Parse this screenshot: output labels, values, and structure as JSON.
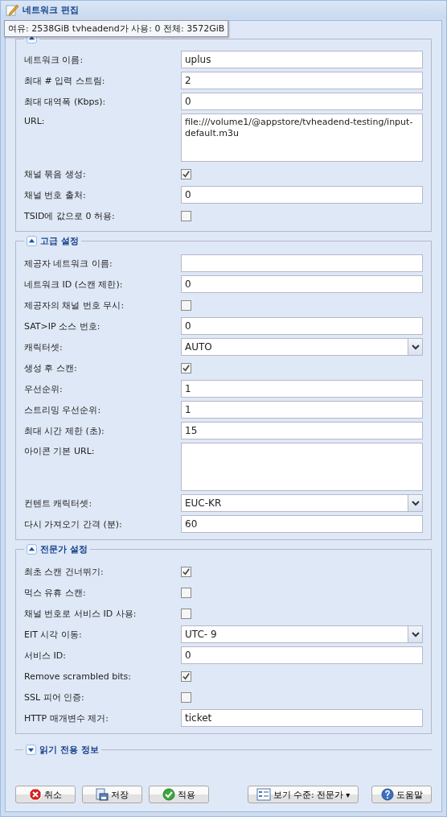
{
  "window": {
    "title": "네트워크 편집"
  },
  "tooltip": "여유: 2538GiB tvheadend가 사용: 0 전체: 3572GiB",
  "sections": [
    {
      "expanded": true,
      "rows": [
        {
          "kind": "text",
          "label": "네트워크 이름:",
          "value": "uplus"
        },
        {
          "kind": "text",
          "label": "최대 # 입력 스트림:",
          "value": "2"
        },
        {
          "kind": "text",
          "label": "최대 대역폭 (Kbps):",
          "value": "0"
        },
        {
          "kind": "textarea",
          "label": "URL:",
          "value": "file:///volume1/@appstore/tvheadend-testing/input-default.m3u"
        },
        {
          "kind": "checkbox",
          "label": "채널 묶음 생성:",
          "checked": true
        },
        {
          "kind": "text",
          "label": "채널 번호 출처:",
          "value": "0"
        },
        {
          "kind": "checkbox",
          "label": "TSID에 값으로 0 허용:",
          "checked": false
        }
      ]
    },
    {
      "title": "고급 설정",
      "expanded": true,
      "rows": [
        {
          "kind": "text",
          "label": "제공자 네트워크 이름:",
          "value": ""
        },
        {
          "kind": "text",
          "label": "네트워크 ID (스캔 제한):",
          "value": "0"
        },
        {
          "kind": "checkbox",
          "label": "제공자의 채널 번호 무시:",
          "checked": false
        },
        {
          "kind": "text",
          "label": "SAT>IP 소스 번호:",
          "value": "0"
        },
        {
          "kind": "select",
          "label": "캐릭터셋:",
          "value": "AUTO"
        },
        {
          "kind": "checkbox",
          "label": "생성 후 스캔:",
          "checked": true
        },
        {
          "kind": "text",
          "label": "우선순위:",
          "value": "1"
        },
        {
          "kind": "text",
          "label": "스트리밍 우선순위:",
          "value": "1"
        },
        {
          "kind": "text",
          "label": "최대 시간 제한 (초):",
          "value": "15"
        },
        {
          "kind": "textarea",
          "label": "아이콘 기본 URL:",
          "value": ""
        },
        {
          "kind": "select",
          "label": "컨텐트 캐릭터셋:",
          "value": "EUC-KR"
        },
        {
          "kind": "text",
          "label": "다시 가져오기 간격 (분):",
          "value": "60"
        }
      ]
    },
    {
      "title": "전문가 설정",
      "expanded": true,
      "rows": [
        {
          "kind": "checkbox",
          "label": "최초 스캔 건너뛰기:",
          "checked": true
        },
        {
          "kind": "checkbox",
          "label": "먹스 유휴 스캔:",
          "checked": false
        },
        {
          "kind": "checkbox",
          "label": "채널 번호로 서비스 ID 사용:",
          "checked": false
        },
        {
          "kind": "select",
          "label": "EIT 시각 이동:",
          "value": "UTC- 9"
        },
        {
          "kind": "text",
          "label": "서비스 ID:",
          "value": "0"
        },
        {
          "kind": "checkbox",
          "label": "Remove scrambled bits:",
          "checked": true
        },
        {
          "kind": "checkbox",
          "label": "SSL 피어 인증:",
          "checked": false
        },
        {
          "kind": "text",
          "label": "HTTP 매개변수 제거:",
          "value": "ticket"
        }
      ]
    },
    {
      "title": "읽기 전용 정보",
      "expanded": false
    }
  ],
  "buttons": [
    {
      "kind": "cancel",
      "label": "취소"
    },
    {
      "kind": "save",
      "label": "저장"
    },
    {
      "kind": "apply",
      "label": "적용"
    },
    {
      "kind": "view",
      "label": "보기 수준: 전문가",
      "caret": "▾"
    },
    {
      "kind": "help",
      "label": "도움말"
    }
  ]
}
